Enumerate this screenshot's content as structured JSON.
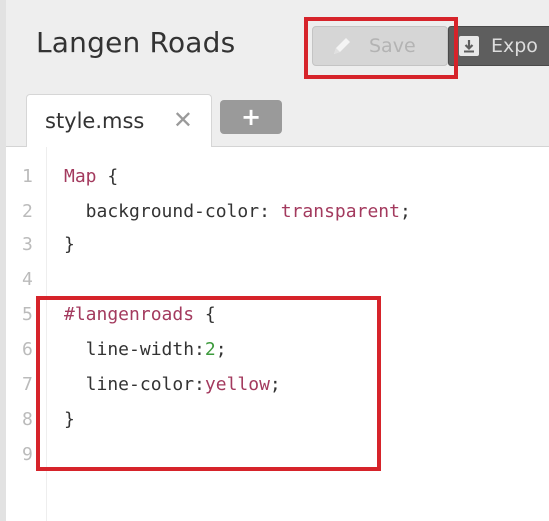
{
  "header": {
    "title": "Langen Roads",
    "save_label": "Save",
    "export_label": "Expo"
  },
  "tabs": [
    {
      "label": "style.mss",
      "close": "✕"
    }
  ],
  "add_tab_label": "+",
  "editor": {
    "line_numbers": [
      "1",
      "2",
      "3",
      "4",
      "5",
      "6",
      "7",
      "8",
      "9"
    ],
    "lines": [
      {
        "p1": "Map",
        "p2": " {"
      },
      {
        "p1": "  background-color: ",
        "p2": "transparent",
        "p3": ";"
      },
      {
        "p1": "}"
      },
      {
        "p1": ""
      },
      {
        "p1": "#langenroads",
        "p2": " {"
      },
      {
        "p1": "  line-width:",
        "p2": "2",
        "p3": ";"
      },
      {
        "p1": "  line-color:",
        "p2": "yellow",
        "p3": ";"
      },
      {
        "p1": "}"
      }
    ]
  },
  "colors": {
    "highlight": "#d6232a",
    "selector": "#a33a5e",
    "number": "#3c9a3c"
  }
}
